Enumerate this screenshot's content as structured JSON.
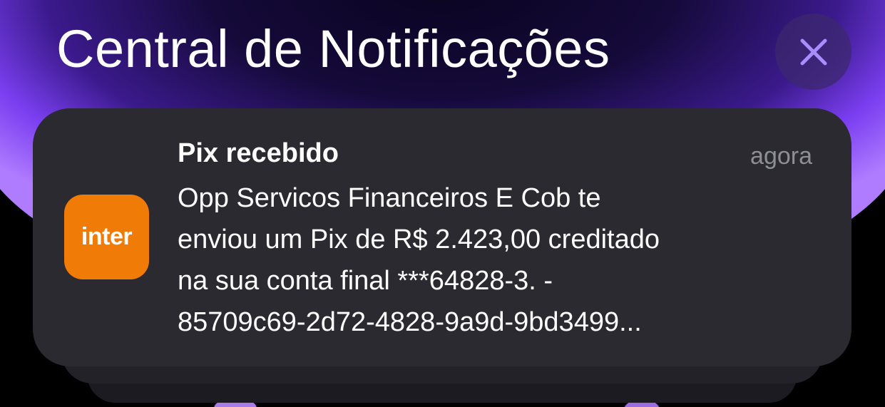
{
  "header": {
    "title": "Central de Notificações",
    "close_icon": "close-icon"
  },
  "notification": {
    "app_icon": {
      "name": "inter-app-icon",
      "label": "inter",
      "color": "#f07b06"
    },
    "title": "Pix recebido",
    "time": "agora",
    "body": "Opp Servicos Financeiros E Cob te\nenviou um Pix de R$ 2.423,00 creditado\nna sua conta final ***64828-3. -\n85709c69-2d72-4828-9a9d-9bd3499..."
  },
  "colors": {
    "wallpaper_accent": "#7a3ef0",
    "card_background": "#2a2a30",
    "close_button": "#a98cff"
  }
}
